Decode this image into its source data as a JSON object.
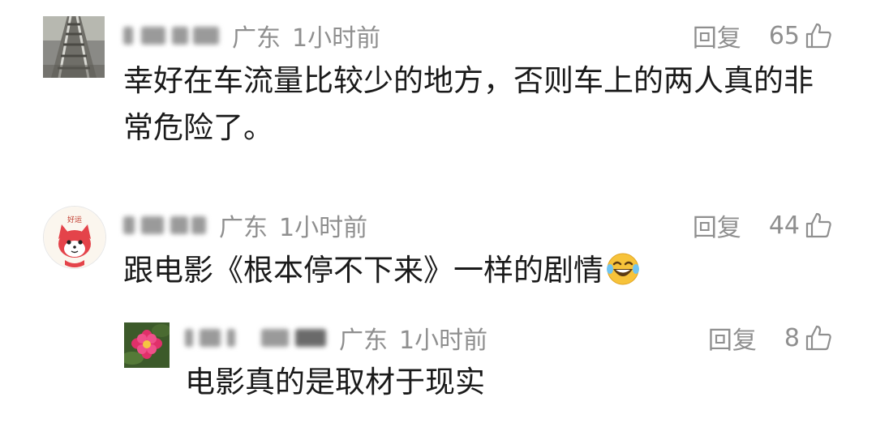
{
  "comments": [
    {
      "location": "广东",
      "time": "1小时前",
      "reply_label": "回复",
      "likes": "65",
      "text_line1": "幸好在车流量比较少的地方，否则车上的两人真的非",
      "text_line2": "常危险了。",
      "avatar_icon": "railway-track-photo"
    },
    {
      "location": "广东",
      "time": "1小时前",
      "reply_label": "回复",
      "likes": "44",
      "text": "跟电影《根本停不下来》一样的剧情",
      "emoji_icon": "laughing-crying-emoji",
      "avatar_icon": "cartoon-fox-avatar",
      "avatar_caption": "好运"
    },
    {
      "location": "广东",
      "time": "1小时前",
      "reply_label": "回复",
      "likes": "8",
      "text": "电影真的是取材于现实",
      "avatar_icon": "red-flower-photo"
    }
  ],
  "colors": {
    "meta_gray": "#8f8f8f",
    "text": "#1a1a1a",
    "background": "#ffffff"
  }
}
